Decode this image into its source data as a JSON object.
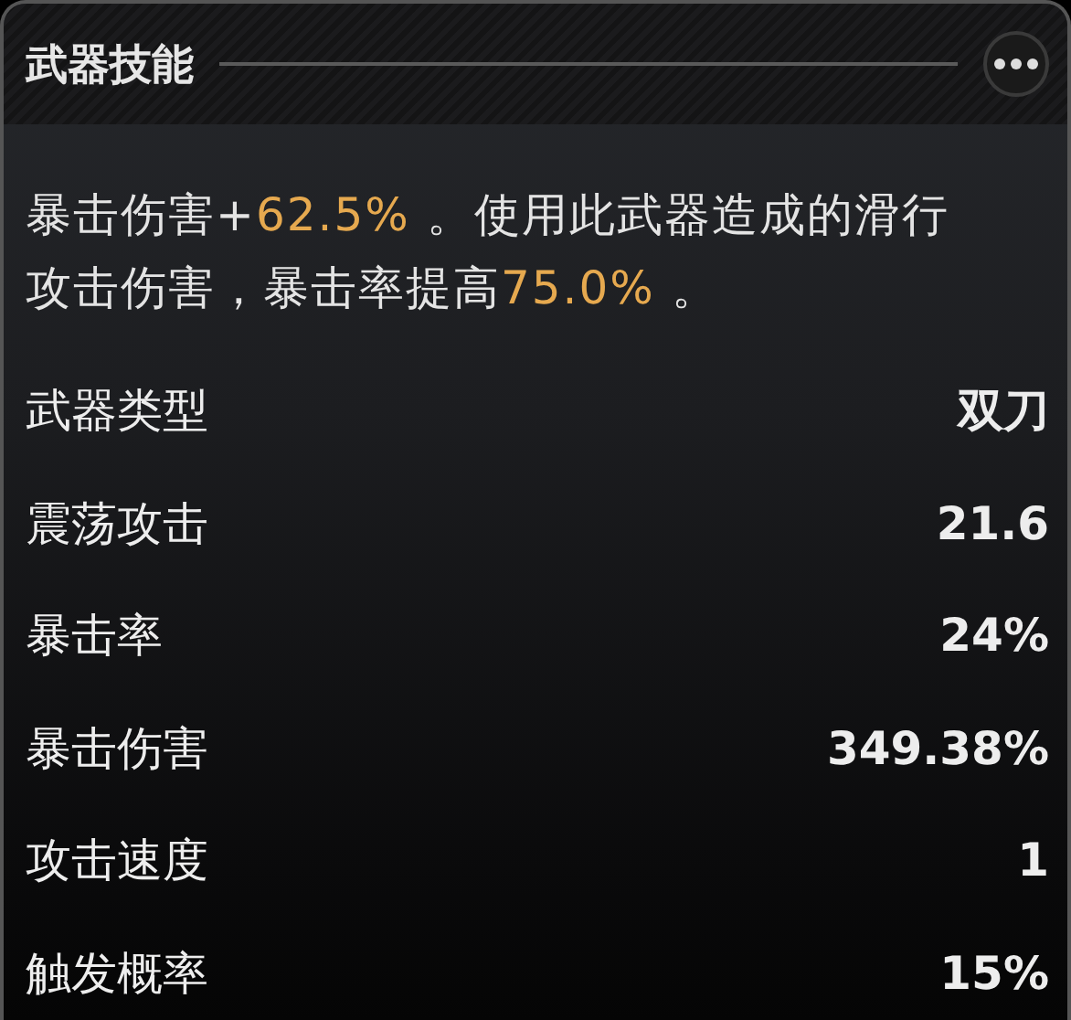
{
  "panel": {
    "title": "武器技能",
    "description": [
      {
        "text": "暴击伤害+",
        "highlight": false
      },
      {
        "text": "62.5%",
        "highlight": true
      },
      {
        "text": " 。使用此武器造成的滑行攻击伤害，暴击率提高",
        "highlight": false
      },
      {
        "text": "75.0%",
        "highlight": true
      },
      {
        "text": " 。",
        "highlight": false
      }
    ],
    "stats": [
      {
        "label": "武器类型",
        "value": "双刀"
      },
      {
        "label": "震荡攻击",
        "value": "21.6"
      },
      {
        "label": "暴击率",
        "value": "24%"
      },
      {
        "label": "暴击伤害",
        "value": "349.38%"
      },
      {
        "label": "攻击速度",
        "value": "1"
      },
      {
        "label": "触发概率",
        "value": "15%"
      }
    ]
  }
}
